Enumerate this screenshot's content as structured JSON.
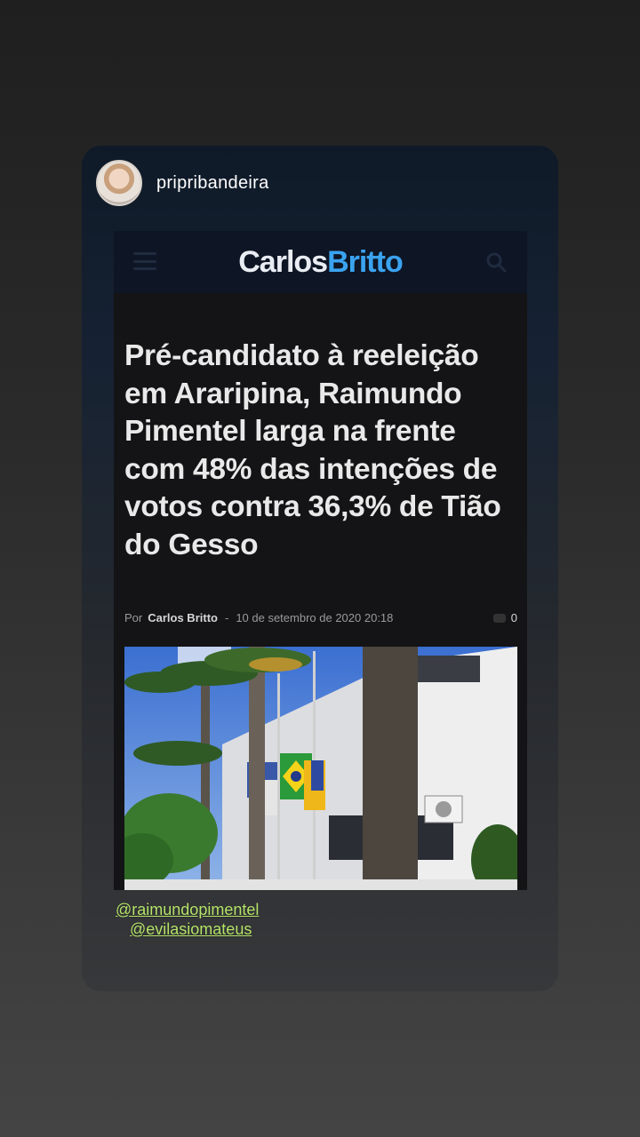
{
  "story": {
    "username": "pripribandeira",
    "mentions": [
      "@raimundopimentel",
      "@evilasiomateus"
    ]
  },
  "article": {
    "logo_part1": "Carlos",
    "logo_part2": "Britto",
    "headline": "Pré-candidato à reeleição em Araripina, Raimundo Pimentel larga na frente com 48% das intenções de votos contra 36,3% de Tião do Gesso",
    "byline_prefix": "Por",
    "author": "Carlos Britto",
    "separator": "-",
    "date": "10 de setembro de 2020 20:18",
    "comment_count": "0"
  },
  "colors": {
    "logo_accent": "#3aa3f0",
    "mention": "#b5e46a"
  },
  "icons": [
    "menu-icon",
    "search-icon",
    "comment-icon"
  ]
}
